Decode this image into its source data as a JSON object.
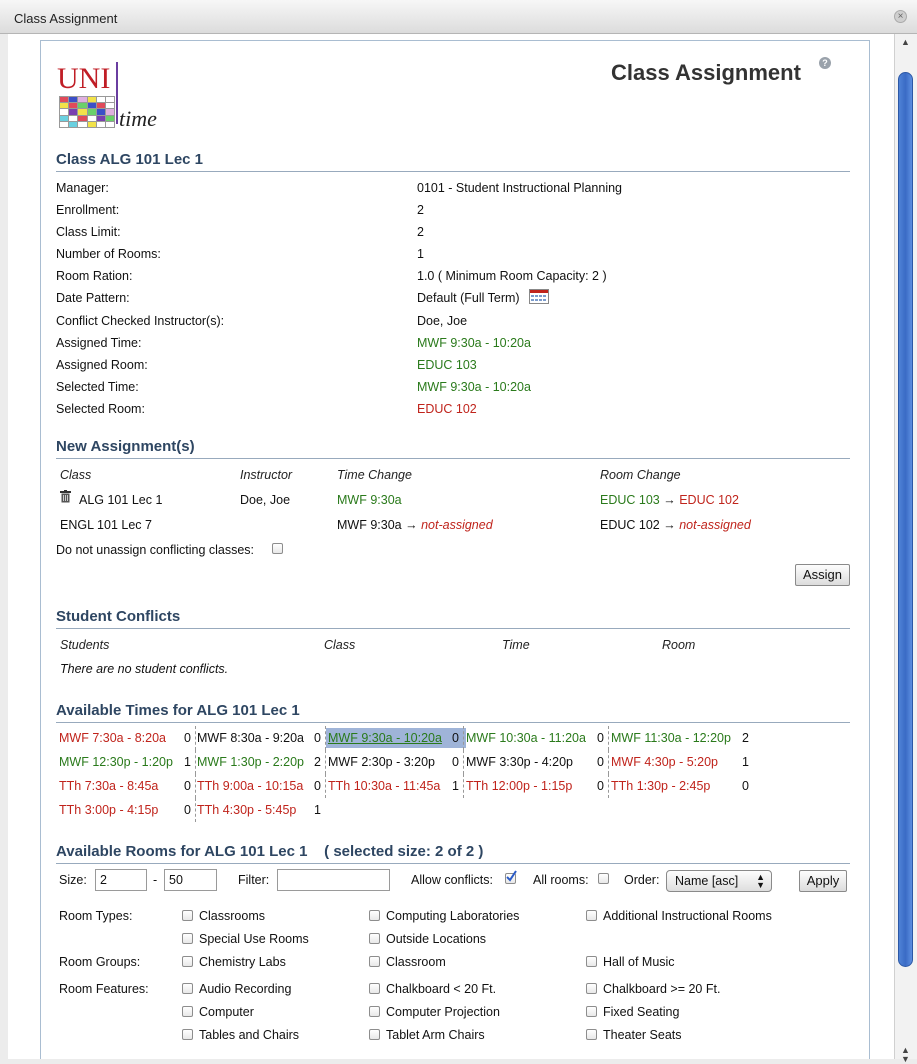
{
  "window": {
    "title": "Class Assignment"
  },
  "logo": {
    "uni": "UNI",
    "time": "time"
  },
  "page": {
    "title": "Class Assignment"
  },
  "class_section": {
    "title": "Class ALG 101 Lec 1",
    "rows": [
      {
        "label": "Manager:",
        "value": "0101 - Student Instructional Planning"
      },
      {
        "label": "Enrollment:",
        "value": "2"
      },
      {
        "label": "Class Limit:",
        "value": "2"
      },
      {
        "label": "Number of Rooms:",
        "value": "1"
      },
      {
        "label": "Room Ration:",
        "value": "1.0 ( Minimum Room Capacity: 2 )"
      },
      {
        "label": "Date Pattern:",
        "value": "Default (Full Term)"
      },
      {
        "label": "Conflict Checked Instructor(s):",
        "value": "Doe, Joe"
      },
      {
        "label": "Assigned Time:",
        "value": "MWF 9:30a - 10:20a"
      },
      {
        "label": "Assigned Room:",
        "value": "EDUC 103"
      },
      {
        "label": "Selected Time:",
        "value": "MWF 9:30a - 10:20a"
      },
      {
        "label": "Selected Room:",
        "value": "EDUC 102"
      }
    ]
  },
  "new_assignments": {
    "title": "New Assignment(s)",
    "headers": {
      "class": "Class",
      "instructor": "Instructor",
      "time_change": "Time Change",
      "room_change": "Room Change"
    },
    "rows": [
      {
        "class": "ALG 101 Lec 1",
        "instructor": "Doe, Joe",
        "time_from": "MWF 9:30a",
        "time_to": "",
        "room_from": "EDUC 103",
        "room_to": "EDUC 102"
      },
      {
        "class": "ENGL 101 Lec 7",
        "instructor": "",
        "time_from": "MWF 9:30a",
        "time_to": "not-assigned",
        "room_from": "EDUC 102",
        "room_to": "not-assigned"
      }
    ],
    "arrow": "→",
    "do_not_unassign_label": "Do not unassign conflicting classes:",
    "assign_button": "Assign"
  },
  "student_conflicts": {
    "title": "Student Conflicts",
    "headers": {
      "students": "Students",
      "class": "Class",
      "time": "Time",
      "room": "Room"
    },
    "empty_message": "There are no student conflicts."
  },
  "available_times": {
    "title": "Available Times for ALG 101 Lec 1",
    "rows": [
      [
        {
          "time": "MWF 7:30a - 8:20a",
          "count": "0",
          "color": "red"
        },
        {
          "time": "MWF 8:30a - 9:20a",
          "count": "0",
          "color": "black"
        },
        {
          "time": "MWF 9:30a - 10:20a",
          "count": "0",
          "color": "green",
          "selected": true
        },
        {
          "time": "MWF 10:30a - 11:20a",
          "count": "0",
          "color": "green"
        },
        {
          "time": "MWF 11:30a - 12:20p",
          "count": "2",
          "color": "green"
        }
      ],
      [
        {
          "time": "MWF 12:30p - 1:20p",
          "count": "1",
          "color": "green"
        },
        {
          "time": "MWF 1:30p - 2:20p",
          "count": "2",
          "color": "green"
        },
        {
          "time": "MWF 2:30p - 3:20p",
          "count": "0",
          "color": "black"
        },
        {
          "time": "MWF 3:30p - 4:20p",
          "count": "0",
          "color": "black"
        },
        {
          "time": "MWF 4:30p - 5:20p",
          "count": "1",
          "color": "red"
        }
      ],
      [
        {
          "time": "TTh 7:30a - 8:45a",
          "count": "0",
          "color": "red"
        },
        {
          "time": "TTh 9:00a - 10:15a",
          "count": "0",
          "color": "red"
        },
        {
          "time": "TTh 10:30a - 11:45a",
          "count": "1",
          "color": "red"
        },
        {
          "time": "TTh 12:00p - 1:15p",
          "count": "0",
          "color": "red"
        },
        {
          "time": "TTh 1:30p - 2:45p",
          "count": "0",
          "color": "red"
        }
      ],
      [
        {
          "time": "TTh 3:00p - 4:15p",
          "count": "0",
          "color": "red"
        },
        {
          "time": "TTh 4:30p - 5:45p",
          "count": "1",
          "color": "red"
        }
      ]
    ]
  },
  "available_rooms": {
    "title": "Available Rooms for ALG 101 Lec 1",
    "selected_size": "( selected size: 2 of 2 )",
    "size_label": "Size:",
    "size_min": "2",
    "size_dash": "-",
    "size_max": "50",
    "filter_label": "Filter:",
    "filter_value": "",
    "allow_conflicts_label": "Allow conflicts:",
    "allow_conflicts_checked": true,
    "all_rooms_label": "All rooms:",
    "all_rooms_checked": false,
    "order_label": "Order:",
    "order_value": "Name [asc]",
    "apply_button": "Apply",
    "room_types_label": "Room Types:",
    "room_types": [
      "Classrooms",
      "Computing Laboratories",
      "Additional Instructional Rooms",
      "Special Use Rooms",
      "Outside Locations"
    ],
    "room_groups_label": "Room Groups:",
    "room_groups": [
      "Chemistry Labs",
      "Classroom",
      "Hall of Music"
    ],
    "room_features_label": "Room Features:",
    "room_features": [
      "Audio Recording",
      "Chalkboard < 20 Ft.",
      "Chalkboard >= 20 Ft.",
      "Computer",
      "Computer Projection",
      "Fixed Seating",
      "Tables and Chairs",
      "Tablet Arm Chairs",
      "Theater Seats"
    ]
  },
  "icons": {
    "close": "close-icon",
    "help": "help-icon",
    "calendar": "calendar-icon",
    "trash": "trash-icon"
  },
  "colors": {
    "green": "#2a7a1b",
    "red": "#c0241c",
    "section_title": "#2e4662",
    "selected_bg": "#9fb4d8"
  }
}
